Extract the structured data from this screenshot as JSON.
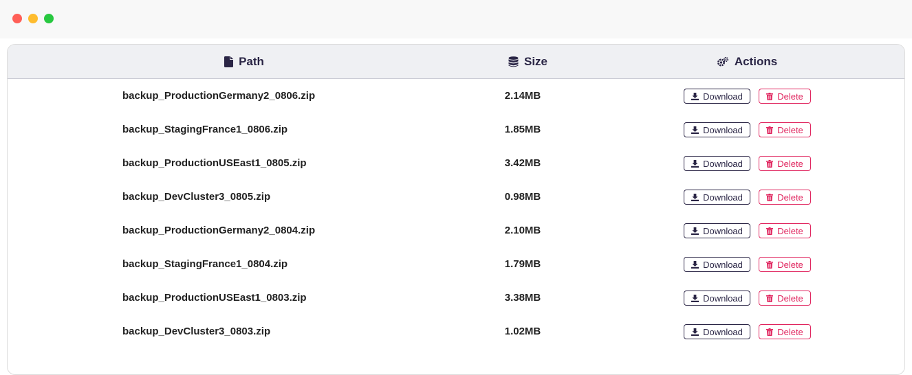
{
  "table": {
    "headers": {
      "path": "Path",
      "size": "Size",
      "actions": "Actions"
    },
    "header_icons": {
      "path": "file-icon",
      "size": "database-icon",
      "actions": "cogs-icon"
    },
    "actions": {
      "download_label": "Download",
      "delete_label": "Delete"
    },
    "rows": [
      {
        "path": "backup_ProductionGermany2_0806.zip",
        "size": "2.14MB"
      },
      {
        "path": "backup_StagingFrance1_0806.zip",
        "size": "1.85MB"
      },
      {
        "path": "backup_ProductionUSEast1_0805.zip",
        "size": "3.42MB"
      },
      {
        "path": "backup_DevCluster3_0805.zip",
        "size": "0.98MB"
      },
      {
        "path": "backup_ProductionGermany2_0804.zip",
        "size": "2.10MB"
      },
      {
        "path": "backup_StagingFrance1_0804.zip",
        "size": "1.79MB"
      },
      {
        "path": "backup_ProductionUSEast1_0803.zip",
        "size": "3.38MB"
      },
      {
        "path": "backup_DevCluster3_0803.zip",
        "size": "1.02MB"
      }
    ]
  },
  "colors": {
    "header_text": "#2a2545",
    "download_border": "#2a2545",
    "delete_accent": "#e0245e",
    "header_bg": "#eff0f3"
  }
}
